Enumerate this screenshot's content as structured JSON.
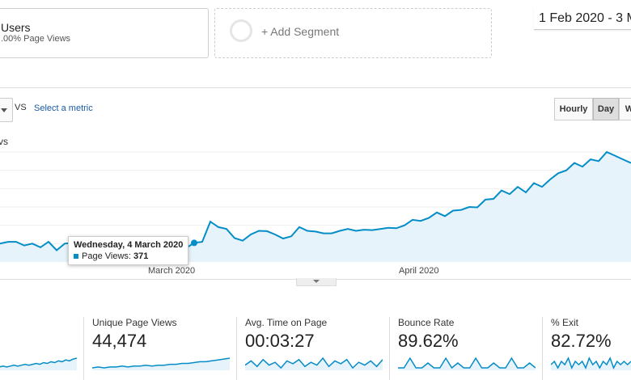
{
  "segments": {
    "active_segment": {
      "title": "Users",
      "subtitle": ".00% Page Views"
    },
    "add_segment_label": "+ Add Segment"
  },
  "date_range": "1 Feb 2020 - 3 M",
  "metric_selector": {
    "vs_label": "VS",
    "select_metric_label": "Select a metric"
  },
  "granularity": {
    "hourly": "Hourly",
    "day": "Day",
    "week": "W",
    "active": "Day"
  },
  "chart": {
    "metric_label": "vs"
  },
  "tooltip": {
    "date": "Wednesday, 4 March 2020",
    "metric_label": "Page Views:",
    "metric_value": "371"
  },
  "colors": {
    "series": "#058dc7",
    "fill": "#e6f3fa"
  },
  "chart_data": {
    "type": "area",
    "series": [
      {
        "name": "Page Views",
        "values": [
          200,
          205,
          205,
          195,
          200,
          190,
          205,
          182,
          200,
          202,
          205,
          197,
          200,
          198,
          210,
          205,
          206,
          205,
          210,
          202,
          205,
          207,
          195,
          188,
          202,
          205,
          260,
          245,
          240,
          215,
          208,
          225,
          235,
          234,
          225,
          214,
          220,
          245,
          235,
          233,
          228,
          228,
          235,
          240,
          235,
          238,
          237,
          240,
          243,
          242,
          250,
          265,
          262,
          270,
          285,
          275,
          290,
          292,
          300,
          299,
          320,
          322,
          345,
          335,
          355,
          340,
          365,
          355,
          375,
          392,
          400,
          420,
          410,
          430,
          425,
          450,
          440,
          430,
          420
        ]
      }
    ],
    "x_labels": [
      "March 2020",
      "April 2020"
    ],
    "ylim": [
      150,
      450
    ],
    "grid": true
  },
  "scorecards": [
    {
      "title": "",
      "value": "",
      "spark": [
        2,
        3,
        3,
        4,
        3,
        4,
        5,
        4,
        5,
        6,
        5,
        6,
        7,
        6,
        8,
        7,
        9,
        8,
        10,
        9,
        11,
        10,
        12,
        13
      ]
    },
    {
      "title": "Unique Page Views",
      "value": "44,474",
      "spark": [
        2,
        3,
        2,
        3,
        3,
        4,
        3,
        4,
        4,
        5,
        4,
        5,
        5,
        6,
        6,
        7,
        7,
        8,
        9,
        9,
        10,
        11,
        12,
        13
      ]
    },
    {
      "title": "Avg. Time on Page",
      "value": "00:03:27",
      "spark": [
        6,
        9,
        5,
        10,
        6,
        8,
        4,
        9,
        7,
        10,
        5,
        8,
        6,
        11,
        5,
        9,
        7,
        10,
        4,
        8,
        6,
        9,
        5,
        10
      ]
    },
    {
      "title": "Bounce Rate",
      "value": "89.62%",
      "spark": [
        8,
        8,
        8.2,
        8,
        8,
        8.1,
        8,
        8,
        8.2,
        8,
        8.1,
        8,
        8,
        8.2,
        8,
        8,
        8.1,
        8,
        8,
        8.2,
        8,
        8,
        8.1,
        8
      ]
    },
    {
      "title": "% Exit",
      "value": "82.72%",
      "spark": [
        8,
        9,
        7,
        9,
        8,
        10,
        7,
        9,
        8,
        9,
        7,
        10,
        8,
        9,
        7,
        9,
        8,
        10,
        7,
        9,
        8,
        9,
        8,
        9
      ]
    }
  ]
}
